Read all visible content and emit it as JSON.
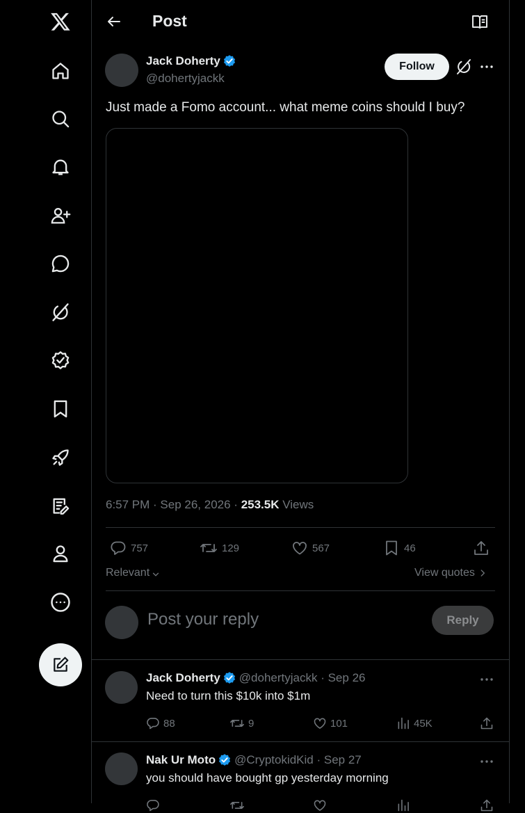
{
  "header": {
    "title": "Post"
  },
  "post": {
    "author_name": "Jack Doherty",
    "author_handle": "@dohertyjackk",
    "follow_label": "Follow",
    "text": "Just made a Fomo account... what meme coins should I buy?",
    "time": "6:57 PM",
    "date": "Sep 26, 2026",
    "views_count": "253.5K",
    "views_label": "Views",
    "stats": {
      "replies": "757",
      "reposts": "129",
      "likes": "567",
      "bookmarks": "46"
    }
  },
  "sort": {
    "label": "Relevant",
    "view_quotes": "View quotes"
  },
  "composer": {
    "placeholder": "Post your reply",
    "reply_label": "Reply"
  },
  "replies": [
    {
      "name": "Jack Doherty",
      "handle": "@dohertyjackk",
      "date": "Sep 26",
      "text": "Need to turn this $10k into $1m",
      "stats": {
        "replies": "88",
        "reposts": "9",
        "likes": "101",
        "views": "45K"
      }
    },
    {
      "name": "Nak Ur Moto",
      "handle": "@CryptokidKid",
      "date": "Sep 27",
      "text": "you should have bought gp yesterday morning"
    }
  ],
  "colors": {
    "accent": "#1d9bf0",
    "background": "#000000",
    "text": "#e7e9ea",
    "muted": "#71767b",
    "border": "#2f3336"
  },
  "icons": [
    "x-logo-icon",
    "home-icon",
    "search-icon",
    "notifications-icon",
    "follow-icon",
    "messages-icon",
    "grok-icon",
    "verified-icon",
    "bookmarks-icon",
    "rocket-icon",
    "lists-icon",
    "profile-icon",
    "more-icon",
    "compose-icon"
  ]
}
